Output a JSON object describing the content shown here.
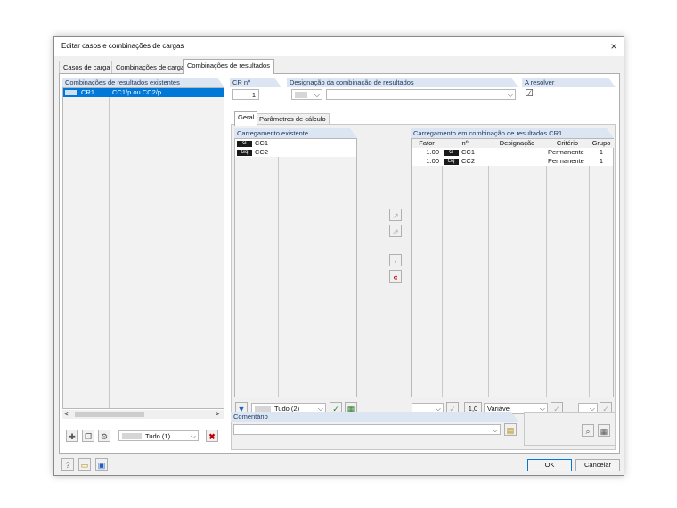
{
  "window": {
    "title": "Editar casos e combinações de cargas",
    "close_glyph": "×"
  },
  "tabs": [
    "Casos de carga",
    "Combinações de cargas",
    "Combinações de resultados"
  ],
  "left_panel": {
    "header": "Combinações de resultados existentes",
    "rows": [
      {
        "id": "CR1",
        "description": "CC1/p ou CC2/p"
      }
    ],
    "filter": "Tudo (1)"
  },
  "cr_number": {
    "label": "CR nº",
    "value": "1"
  },
  "designation": {
    "label": "Designação da combinação de resultados",
    "value": ""
  },
  "to_solve": {
    "label": "A resolver",
    "checked": "☑"
  },
  "subtabs": [
    "Geral",
    "Parâmetros de cálculo"
  ],
  "existing_loading": {
    "header": "Carregamento existente",
    "rows": [
      {
        "tag": "G",
        "name": "CC1"
      },
      {
        "tag": "Gq",
        "name": "CC2"
      }
    ],
    "filter": "Tudo (2)"
  },
  "result_combo": {
    "header": "Carregamento em combinação de resultados CR1",
    "columns": [
      "Fator",
      "nº",
      "Designação",
      "Critério",
      "Grupo"
    ],
    "rows": [
      {
        "factor": "1.00",
        "tag": "G",
        "no": "CC1",
        "designation": "",
        "criterion": "Permanente",
        "group": "1"
      },
      {
        "factor": "1.00",
        "tag": "Gq",
        "no": "CC2",
        "designation": "",
        "criterion": "Permanente",
        "group": "1"
      }
    ],
    "factor_value": "1,0",
    "criterion_value": "Variável"
  },
  "comment": {
    "label": "Comentário",
    "value": ""
  },
  "buttons": {
    "ok": "OK",
    "cancel": "Cancelar"
  },
  "scroll": {
    "left": "<",
    "right": ">"
  }
}
